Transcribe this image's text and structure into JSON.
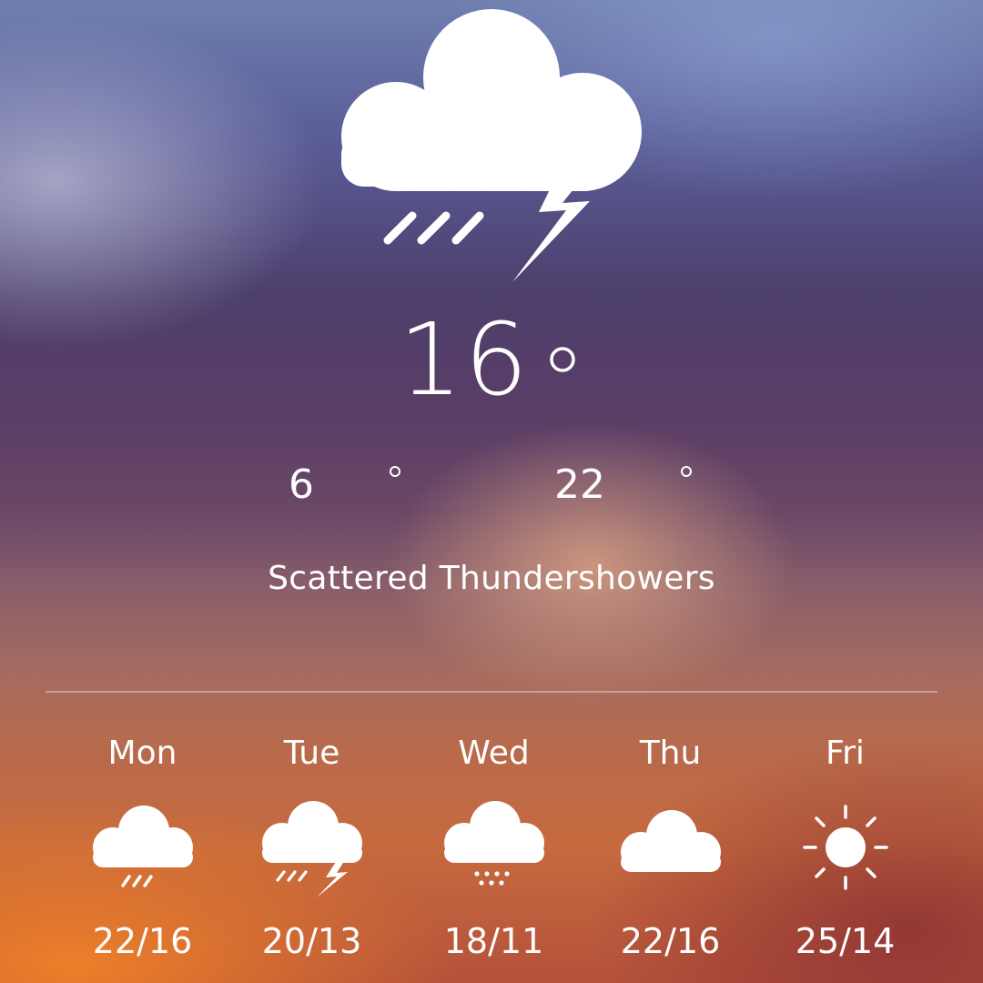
{
  "current": {
    "icon": "thunderstorm-cloud-icon",
    "temperature": "16",
    "low": "6",
    "high": "22",
    "condition": "Scattered Thundershowers"
  },
  "forecast": [
    {
      "day": "Mon",
      "icon": "rain-cloud-icon",
      "temps": "22/16"
    },
    {
      "day": "Tue",
      "icon": "thunderstorm-cloud-icon",
      "temps": "20/13"
    },
    {
      "day": "Wed",
      "icon": "snow-cloud-icon",
      "temps": "18/11"
    },
    {
      "day": "Thu",
      "icon": "cloud-icon",
      "temps": "22/16"
    },
    {
      "day": "Fri",
      "icon": "sun-icon",
      "temps": "25/14"
    }
  ],
  "colors": {
    "text": "#ffffff",
    "divider": "rgba(255,255,255,0.35)"
  }
}
